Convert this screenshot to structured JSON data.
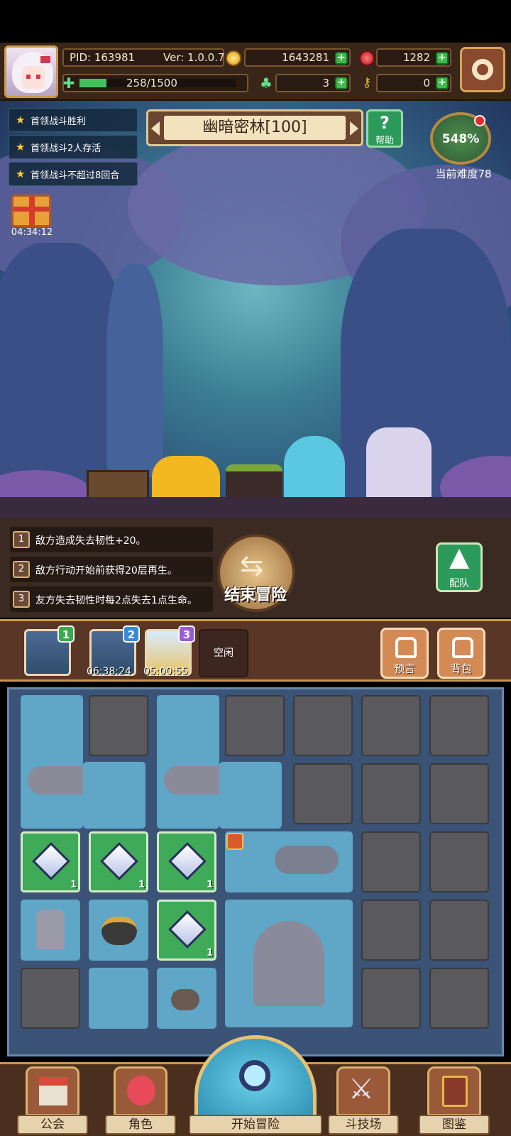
{
  "header": {
    "pid": "PID: 163981",
    "version": "Ver: 1.0.0.7",
    "exp": "258/1500",
    "exp_fraction": 0.172,
    "gold": "1643281",
    "apples": "1282",
    "clovers": "3",
    "keys": "0"
  },
  "quests": [
    "首领战斗胜利",
    "首领战斗2人存活",
    "首领战斗不超过8回合"
  ],
  "stage": {
    "title": "幽暗密林[100]",
    "help": "帮助"
  },
  "difficulty": {
    "percent": "548%",
    "label": "当前难度78"
  },
  "gift": {
    "timer": "04:34:12"
  },
  "rules": [
    {
      "num": "1",
      "text": "敌方造成失去韧性+20。"
    },
    {
      "num": "2",
      "text": "敌方行动开始前获得20层再生。"
    },
    {
      "num": "3",
      "text": "友方失去韧性时每2点失去1点生命。"
    }
  ],
  "end_adventure": "结束冒险",
  "team_button": "配队",
  "slots": [
    {
      "badge": "1",
      "timer": ""
    },
    {
      "badge": "2",
      "timer": "06:38:24"
    },
    {
      "badge": "3",
      "timer": "05:00:55"
    }
  ],
  "idle_label": "空闲",
  "prophecy_button": "预言",
  "backpack_button": "背包",
  "grid_counts": [
    "1",
    "1",
    "1",
    "1"
  ],
  "nav": {
    "guild": "公会",
    "character": "角色",
    "start": "开始冒险",
    "arena": "斗技场",
    "codex": "图鉴"
  },
  "colors": {
    "accent_gold": "#c99a4e",
    "green_button": "#2c9a5a",
    "plus_green": "#3cbb4a"
  }
}
